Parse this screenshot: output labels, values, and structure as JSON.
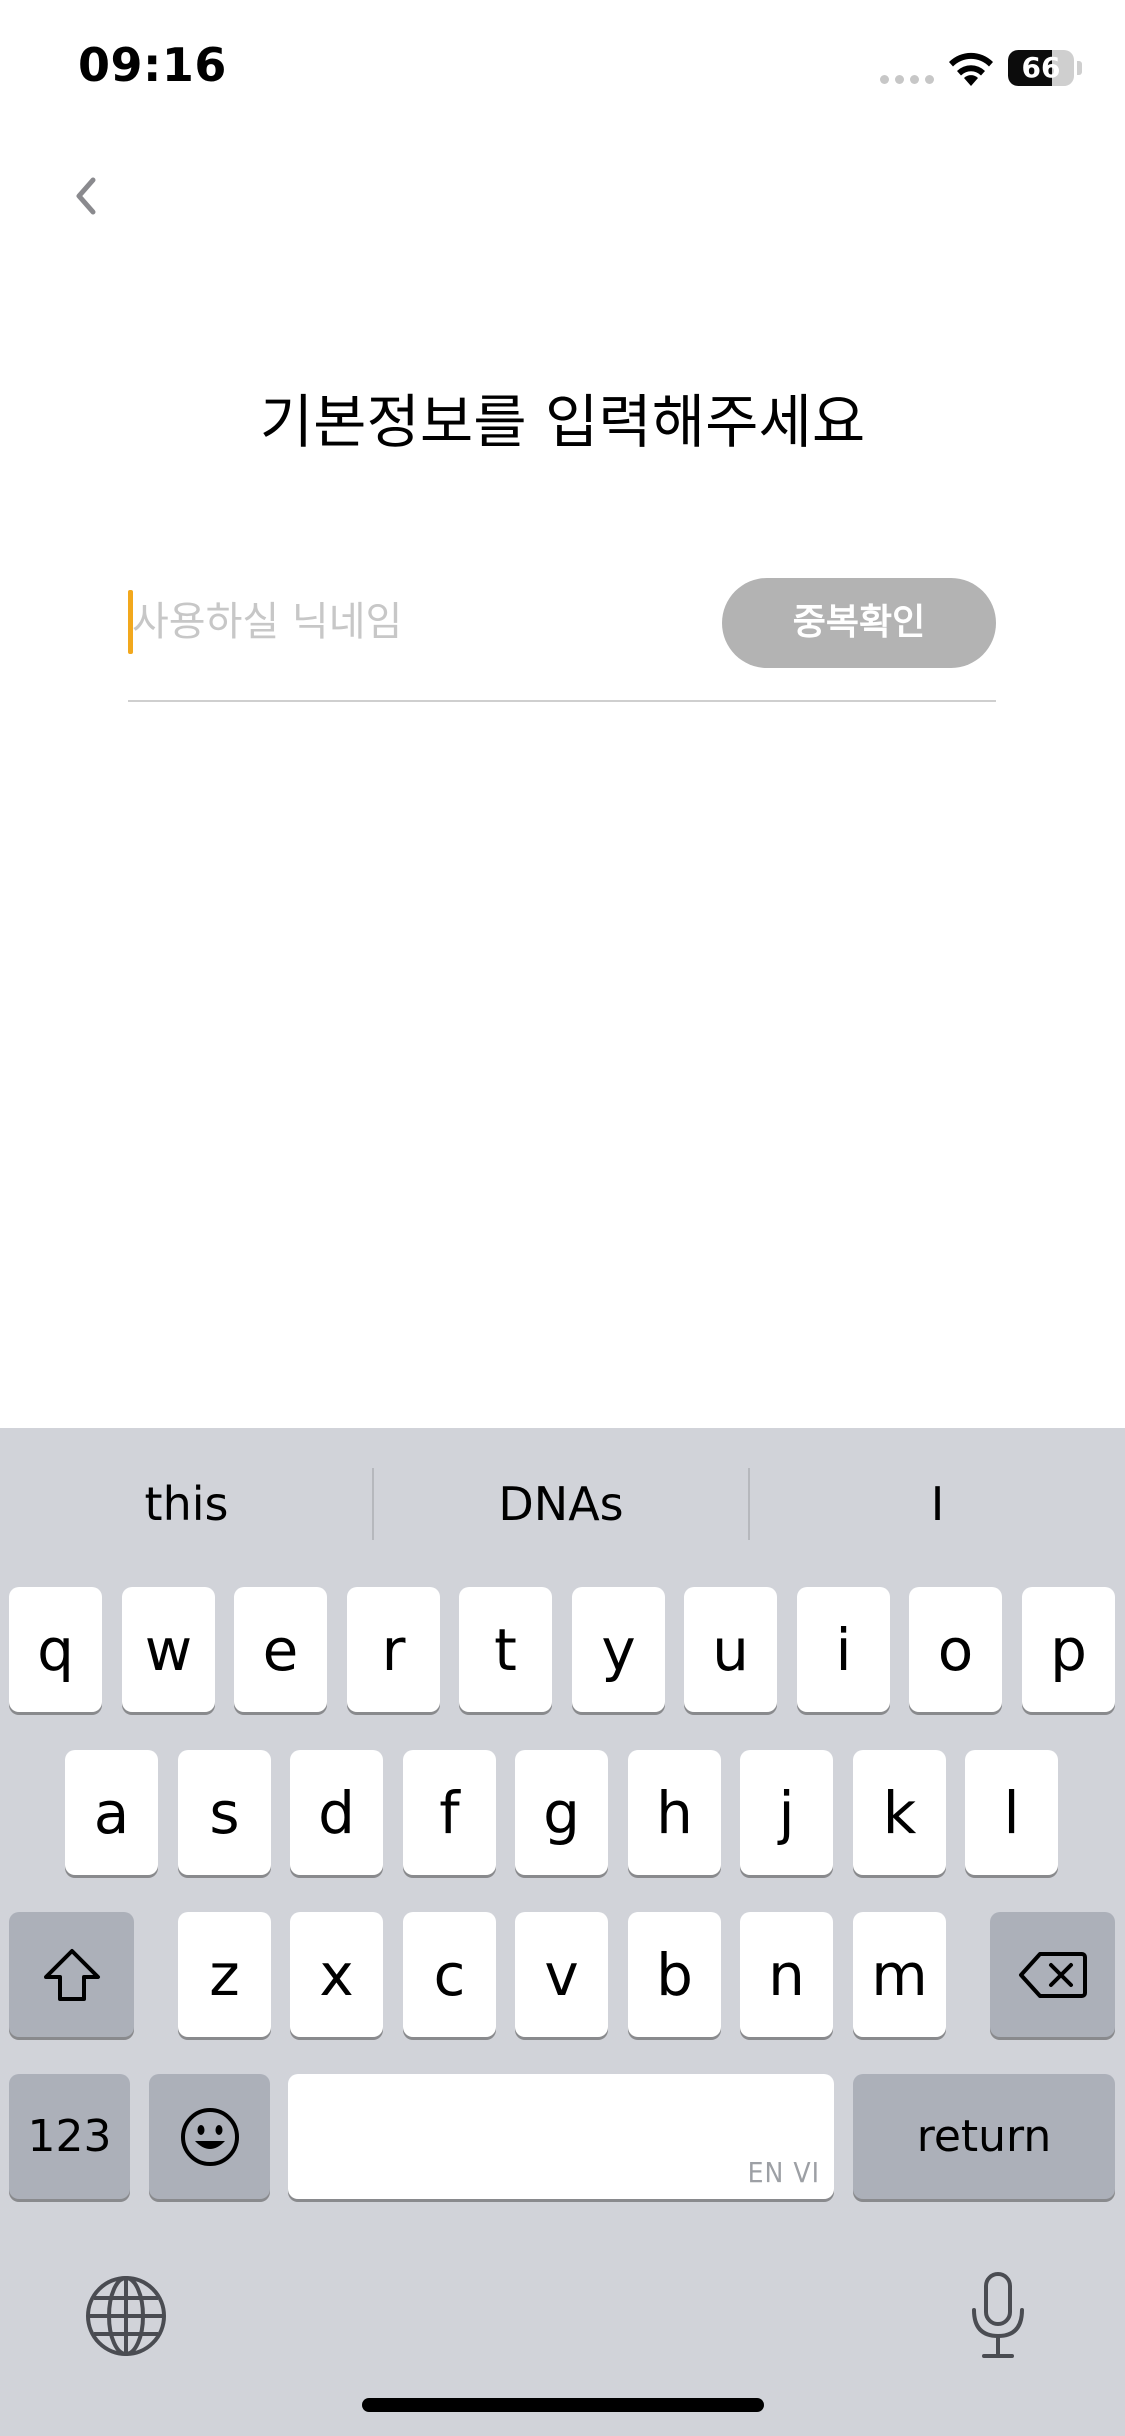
{
  "status_bar": {
    "time": "09:16",
    "battery_level": "66",
    "battery_fraction": 0.66,
    "icons": [
      "cellular-signal-icon",
      "wifi-icon",
      "battery-icon"
    ]
  },
  "nav": {
    "back_icon": "chevron-left-icon"
  },
  "page": {
    "title": "기본정보를 입력해주세요",
    "nickname_placeholder": "사용하실 닉네임",
    "nickname_value": "",
    "duplicate_check_label": "중복확인",
    "accent_color": "#f2a81d",
    "button_color": "#b3b3b3"
  },
  "keyboard": {
    "suggestions": [
      "this",
      "DNAs",
      "I"
    ],
    "row1": [
      "q",
      "w",
      "e",
      "r",
      "t",
      "y",
      "u",
      "i",
      "o",
      "p"
    ],
    "row2": [
      "a",
      "s",
      "d",
      "f",
      "g",
      "h",
      "j",
      "k",
      "l"
    ],
    "row3": [
      "z",
      "x",
      "c",
      "v",
      "b",
      "n",
      "m"
    ],
    "numbers_label": "123",
    "return_label": "return",
    "space_sublabel": "EN VI",
    "shift_icon": "shift-icon",
    "delete_icon": "delete-icon",
    "emoji_icon": "emoji-icon",
    "globe_icon": "globe-icon",
    "mic_icon": "microphone-icon"
  }
}
